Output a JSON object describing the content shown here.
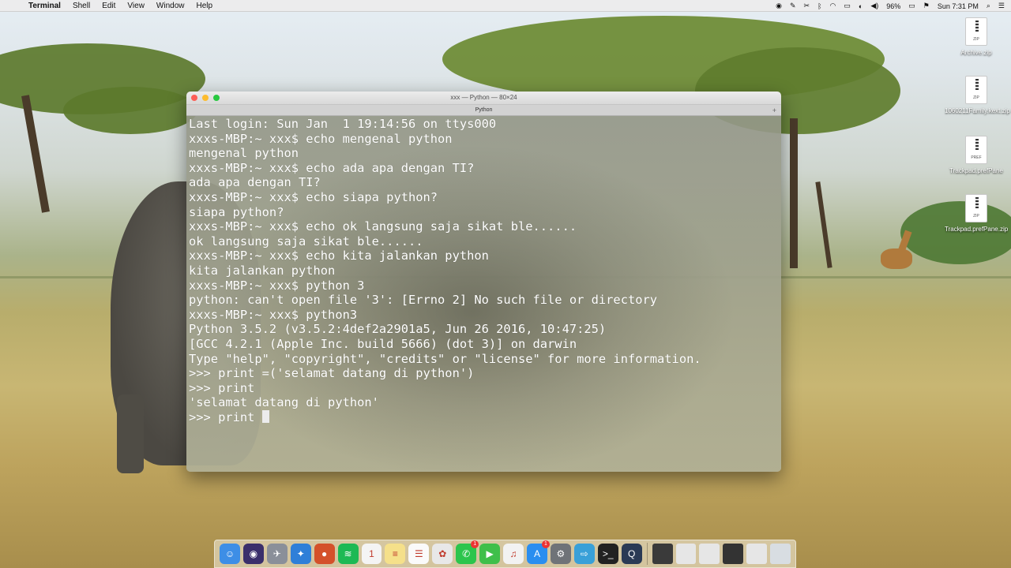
{
  "menubar": {
    "app_name": "Terminal",
    "items": [
      "Shell",
      "Edit",
      "View",
      "Window",
      "Help"
    ],
    "battery": "96%",
    "clock": "Sun 7:31 PM"
  },
  "desktop_icons": [
    {
      "label": "Archive.zip",
      "type": "ZIP"
    },
    {
      "label": "1060211Family.kext.zip",
      "type": "ZIP"
    },
    {
      "label": "Trackpad.prefPane",
      "type": "PREF"
    },
    {
      "label": "Trackpad.prefPane.zip",
      "type": "ZIP"
    }
  ],
  "terminal": {
    "window_title": "xxx — Python — 80×24",
    "tab_title": "Python",
    "lines": [
      "Last login: Sun Jan  1 19:14:56 on ttys000",
      "xxxs-MBP:~ xxx$ echo mengenal python",
      "mengenal python",
      "xxxs-MBP:~ xxx$ echo ada apa dengan TI?",
      "ada apa dengan TI?",
      "xxxs-MBP:~ xxx$ echo siapa python?",
      "siapa python?",
      "xxxs-MBP:~ xxx$ echo ok langsung saja sikat ble......",
      "ok langsung saja sikat ble......",
      "xxxs-MBP:~ xxx$ echo kita jalankan python",
      "kita jalankan python",
      "xxxs-MBP:~ xxx$ python 3",
      "python: can't open file '3': [Errno 2] No such file or directory",
      "xxxs-MBP:~ xxx$ python3",
      "Python 3.5.2 (v3.5.2:4def2a2901a5, Jun 26 2016, 10:47:25)",
      "[GCC 4.2.1 (Apple Inc. build 5666) (dot 3)] on darwin",
      "Type \"help\", \"copyright\", \"credits\" or \"license\" for more information.",
      ">>> print =('selamat datang di python')",
      ">>> print",
      "'selamat datang di python'"
    ],
    "current_input": ">>> print "
  },
  "dock": {
    "apps": [
      {
        "name": "finder-icon",
        "color": "#3d8ee6",
        "glyph": "☺"
      },
      {
        "name": "siri-icon",
        "color": "#3a2f6b",
        "glyph": "◉"
      },
      {
        "name": "launchpad-icon",
        "color": "#8a8f99",
        "glyph": "✈"
      },
      {
        "name": "safari-icon",
        "color": "#2f7fd8",
        "glyph": "✦"
      },
      {
        "name": "firefox-icon",
        "color": "#d4512a",
        "glyph": "●"
      },
      {
        "name": "spotify-icon",
        "color": "#1db954",
        "glyph": "≋"
      },
      {
        "name": "calendar-icon",
        "color": "#f4f4f4",
        "glyph": "1"
      },
      {
        "name": "notes-icon",
        "color": "#f5e08a",
        "glyph": "≡"
      },
      {
        "name": "reminders-icon",
        "color": "#fafafa",
        "glyph": "☰"
      },
      {
        "name": "photos-icon",
        "color": "#e8e8e8",
        "glyph": "✿"
      },
      {
        "name": "whatsapp-icon",
        "color": "#2cc54c",
        "glyph": "✆",
        "badge": "1"
      },
      {
        "name": "facetime-icon",
        "color": "#3fbf4a",
        "glyph": "▶"
      },
      {
        "name": "itunes-icon",
        "color": "#f2f2f2",
        "glyph": "♫"
      },
      {
        "name": "app-store-icon",
        "color": "#2a8ef0",
        "glyph": "A",
        "badge": "1"
      },
      {
        "name": "system-preferences-icon",
        "color": "#6f7378",
        "glyph": "⚙"
      },
      {
        "name": "migration-icon",
        "color": "#39a0d8",
        "glyph": "⇨"
      },
      {
        "name": "terminal-icon",
        "color": "#222222",
        "glyph": ">_"
      },
      {
        "name": "quicktime-icon",
        "color": "#2a3a55",
        "glyph": "Q"
      }
    ],
    "docs": [
      {
        "name": "dock-document-1-icon",
        "color": "#3a3a3a"
      },
      {
        "name": "dock-document-2-icon",
        "color": "#e6e6e6"
      },
      {
        "name": "dock-document-3-icon",
        "color": "#e6e6e6"
      },
      {
        "name": "dock-document-4-icon",
        "color": "#333333"
      },
      {
        "name": "dock-document-5-icon",
        "color": "#e6e6e6"
      },
      {
        "name": "trash-icon",
        "color": "#d8dde2"
      }
    ]
  }
}
